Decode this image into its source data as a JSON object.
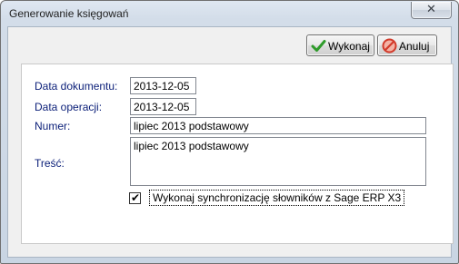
{
  "window": {
    "title": "Generowanie księgowań",
    "close_glyph": "✕"
  },
  "toolbar": {
    "execute_label": "Wykonaj",
    "cancel_label": "Anuluj"
  },
  "form": {
    "data_dokumentu": {
      "label": "Data dokumentu:",
      "value": "2013-12-05"
    },
    "data_operacji": {
      "label": "Data operacji:",
      "value": "2013-12-05"
    },
    "numer": {
      "label": "Numer:",
      "value": "lipiec 2013 podstawowy"
    },
    "tresc": {
      "label": "Treść:",
      "value": "lipiec 2013 podstawowy"
    },
    "sync": {
      "label": "Wykonaj synchronizację słowników z Sage ERP X3",
      "checked": true,
      "mark": "✔"
    }
  },
  "colors": {
    "label_text": "#0a1e78",
    "execute_icon": "#2e9b2a",
    "cancel_icon": "#d23a2a"
  },
  "icons": {
    "execute": "check-icon",
    "cancel": "no-entry-icon",
    "close": "close-icon"
  }
}
